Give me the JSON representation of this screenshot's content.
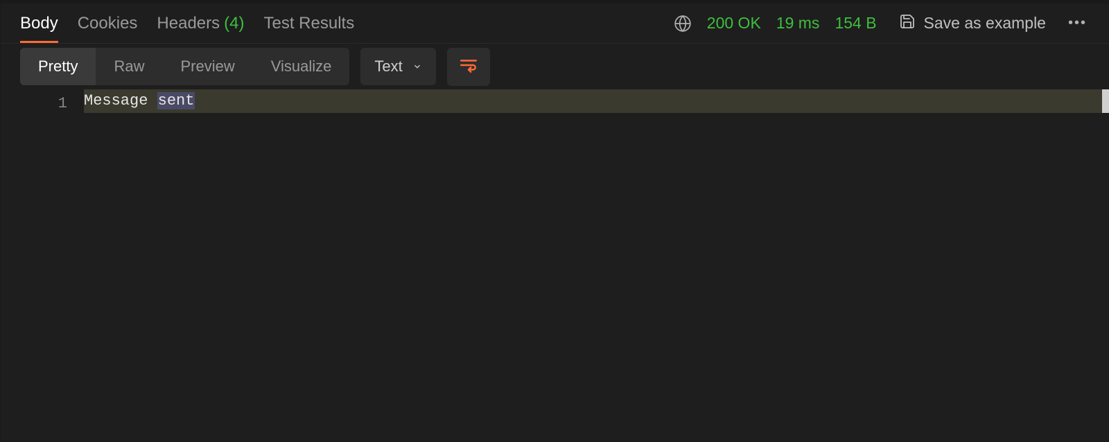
{
  "tabs": {
    "body": {
      "label": "Body"
    },
    "cookies": {
      "label": "Cookies"
    },
    "headers": {
      "label": "Headers",
      "count": "(4)"
    },
    "tests": {
      "label": "Test Results"
    }
  },
  "status": {
    "code": "200 OK",
    "time": "19 ms",
    "size": "154 B"
  },
  "save_example": {
    "label": "Save as example"
  },
  "view_tabs": {
    "pretty": "Pretty",
    "raw": "Raw",
    "preview": "Preview",
    "visualize": "Visualize"
  },
  "format_select": {
    "label": "Text"
  },
  "editor": {
    "lines": [
      {
        "n": "1",
        "text_a": "Message ",
        "text_b": "sent"
      }
    ]
  }
}
